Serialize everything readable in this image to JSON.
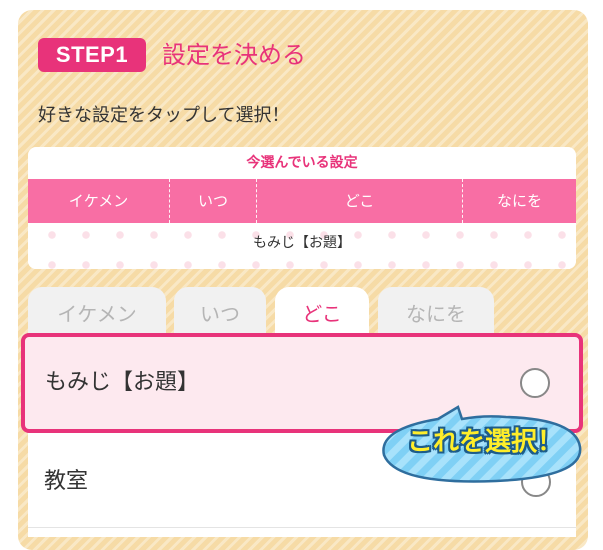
{
  "step": {
    "badge": "STEP1",
    "title": "設定を決める"
  },
  "instruction": "好きな設定をタップして選択！",
  "summary": {
    "title": "今選んでいる設定",
    "columns": [
      "イケメン",
      "いつ",
      "どこ",
      "なにを"
    ],
    "current_value": "もみじ【お題】"
  },
  "tabs": [
    {
      "label": "イケメン",
      "active": false
    },
    {
      "label": "いつ",
      "active": false
    },
    {
      "label": "どこ",
      "active": true
    },
    {
      "label": "なにを",
      "active": false
    }
  ],
  "options": [
    {
      "label": "もみじ【お題】",
      "highlighted": true
    },
    {
      "label": "教室",
      "highlighted": false
    }
  ],
  "callout": "これを選択！",
  "colors": {
    "accent": "#e8337a",
    "header_pink": "#f86ea4",
    "panel": "#f6dba6",
    "callout_blue": "#7fd0f5",
    "callout_text": "#ffee2a"
  }
}
